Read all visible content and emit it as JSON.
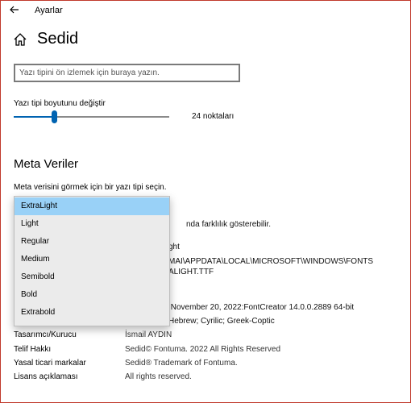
{
  "app_title": "Ayarlar",
  "page_title": "Sedid",
  "preview": {
    "placeholder": "Yazı tipini ön izlemek için buraya yazın."
  },
  "font_size": {
    "label": "Yazı tipi boyutunu değiştir",
    "value_label": "24 noktaları",
    "value": 24,
    "level_fraction": 0.26
  },
  "metadata": {
    "heading": "Meta Veriler",
    "instruction": "Meta verisini görmek için bir yazı tipi seçin.",
    "dropdown_options": [
      "ExtraLight",
      "Light",
      "Regular",
      "Medium",
      "Semibold",
      "Bold",
      "Extrabold"
    ],
    "selected_option": "ExtraLight",
    "partial_texts": [
      "nda farklılık gösterebilir.",
      "ght",
      "MAI\\APPDATA\\LOCAL\\MICROSOFT\\WINDOWS\\FONTS",
      "ALIGHT.TTF",
      ":November 20, 2022:FontCreator 14.0.0.2889 64-bit",
      "Hebrew; Cyrilic; Greek-Coptic"
    ],
    "rows": [
      {
        "label": "Tasarımcı/Kurucu",
        "value": "İsmail AYDIN"
      },
      {
        "label": "Telif Hakkı",
        "value": "Sedid© Fontuma. 2022 All Rights Reserved"
      },
      {
        "label": "Yasal ticari markalar",
        "value": "Sedid® Trademark of Fontuma."
      },
      {
        "label": "Lisans açıklaması",
        "value": "All rights reserved."
      }
    ]
  },
  "colors": {
    "accent": "#0063b1",
    "selection": "#99d1f7",
    "window_border": "#c0392b"
  }
}
